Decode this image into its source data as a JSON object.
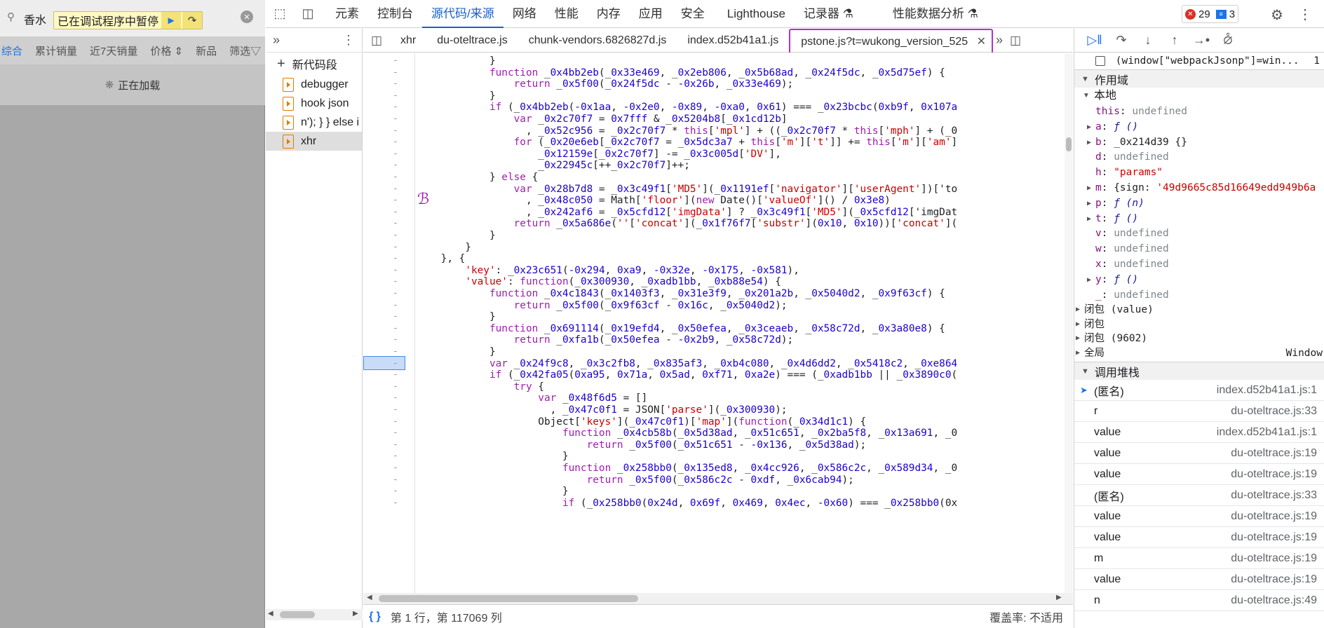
{
  "page": {
    "search_value": "香水",
    "paused_text": "已在调试程序中暂停",
    "filters": [
      "综合",
      "累计销量",
      "近7天销量",
      "价格 ⇕",
      "新品",
      "筛选▽"
    ],
    "loading_text": "正在加载"
  },
  "main_tabs": [
    "元素",
    "控制台",
    "源代码/来源",
    "网络",
    "性能",
    "内存",
    "应用",
    "安全",
    "Lighthouse",
    "记录器 ⚗",
    "性能数据分析 ⚗"
  ],
  "active_main_tab": "源代码/来源",
  "badges": {
    "errors": "29",
    "messages": "3"
  },
  "navigator": {
    "new_snippet": "新代码段",
    "snippets": [
      "debugger",
      "hook json",
      "n'); } } else i",
      "xhr"
    ]
  },
  "file_tabs": [
    "xhr",
    "du-oteltrace.js",
    "chunk-vendors.6826827d.js",
    "index.d52b41a1.js",
    "pstone.js?t=wukong_version_525"
  ],
  "active_file_tab": "pstone.js?t=wukong_version_525",
  "code_lines": [
    "            }",
    "            function _0x4bb2eb(_0x33e469, _0x2eb806, _0x5b68ad, _0x24f5dc, _0x5d75ef) {",
    "                return _0x5f00(_0x24f5dc - -0x26b, _0x33e469);",
    "            }",
    "            if (_0x4bb2eb(-0x1aa, -0x2e0, -0x89, -0xa0, 0x61) === _0x23bcbc(0xb9f, 0x107a",
    "                var _0x2c70f7 = 0x7fff & _0x5204b8[_0x1cd12b]",
    "                  , _0x52c956 = _0x2c70f7 * this['mpl'] + ((_0x2c70f7 * this['mph'] + (_0",
    "                for (_0x20e6eb[_0x2c70f7 = _0x5dc3a7 + this['m']['t']] += this['m']['am']",
    "                    _0x12159e[_0x2c70f7] -= _0x3c005d['DV'],",
    "                    _0x22945c[++_0x2c70f7]++;",
    "            } else {",
    "                var _0x28b7d8 = _0x3c49f1['MD5'](_0x1191ef['navigator']['userAgent'])['to",
    "                  , _0x48c050 = Math['floor'](new Date()['valueOf']() / 0x3e8)",
    "                  , _0x242af6 = _0x5cfd12['imgData'] ? _0x3c49f1['MD5'](_0x5cfd12['imgDat",
    "                return _0x5a686e(''['concat'](_0x1f76f7['substr'](0x10, 0x10))['concat'](",
    "            }",
    "        }",
    "    }, {",
    "        'key': _0x23c651(-0x294, 0xa9, -0x32e, -0x175, -0x581),",
    "        'value': function(_0x300930, _0xadb1bb, _0xb88e54) {",
    "            function _0x4c1843(_0x1403f3, _0x31e3f9, _0x201a2b, _0x5040d2, _0x9f63cf) {",
    "                return _0x5f00(_0x9f63cf - 0x16c, _0x5040d2);",
    "            }",
    "            function _0x691114(_0x19efd4, _0x50efea, _0x3ceaeb, _0x58c72d, _0x3a80e8) {",
    "                return _0xfa1b(_0x50efea - -0x2b9, _0x58c72d);",
    "            }",
    "            var _0x24f9c8, _0x3c2fb8, _0x835af3, _0xb4c080, _0x4d6dd2, _0x5418c2, _0xe864",
    "            if (_0x42fa05(0xa95, 0x71a, 0x5ad, 0xf71, 0xa2e) === (_0xadb1bb || _0x3890c0(",
    "                try {",
    "                    var _0x48f6d5 = []",
    "                      , _0x47c0f1 = JSON['parse'](_0x300930);",
    "                    Object['keys'](_0x47c0f1)['map'](function(_0x34d1c1) {",
    "                        function _0x4cb58b(_0x5d38ad, _0x51c651, _0x2ba5f8, _0x13a691, _0",
    "                            return _0x5f00(_0x51c651 - -0x136, _0x5d38ad);",
    "                        }",
    "                        function _0x258bb0(_0x135ed8, _0x4cc926, _0x586c2c, _0x589d34, _0",
    "                            return _0x5f00(_0x586c2c - 0xdf, _0x6cab94);",
    "                        }",
    "                        if (_0x258bb0(0x24d, 0x69f, 0x469, 0x4ec, -0x60) === _0x258bb0(0x"
  ],
  "breakpoint_line_index": 26,
  "status": {
    "position": "第 1 行，第 117069 列",
    "coverage": "覆盖率: 不适用"
  },
  "scope": {
    "top_entry": "(window[\"webpackJsonp\"]=win...",
    "top_entry_count": "1",
    "header": "作用域",
    "local_header": "本地",
    "vars": [
      {
        "name": "this",
        "value": "undefined",
        "kind": "und",
        "expand": false
      },
      {
        "name": "a",
        "value": "ƒ ()",
        "kind": "fn",
        "expand": true
      },
      {
        "name": "b",
        "value": "_0x214d39 {}",
        "kind": "plain",
        "expand": true
      },
      {
        "name": "d",
        "value": "undefined",
        "kind": "und",
        "expand": false
      },
      {
        "name": "h",
        "value": "\"params\"",
        "kind": "str",
        "expand": false
      },
      {
        "name": "m",
        "value": "{sign: '49d9665c85d16649edd949b6a",
        "kind": "obj",
        "expand": true
      },
      {
        "name": "p",
        "value": "ƒ (n)",
        "kind": "fn",
        "expand": true
      },
      {
        "name": "t",
        "value": "ƒ ()",
        "kind": "fn",
        "expand": true
      },
      {
        "name": "v",
        "value": "undefined",
        "kind": "und",
        "expand": false
      },
      {
        "name": "w",
        "value": "undefined",
        "kind": "und",
        "expand": false
      },
      {
        "name": "x",
        "value": "undefined",
        "kind": "und",
        "expand": false
      },
      {
        "name": "y",
        "value": "ƒ ()",
        "kind": "fn",
        "expand": true
      },
      {
        "name": "_",
        "value": "undefined",
        "kind": "und",
        "expand": false
      }
    ],
    "closures": [
      "闭包 (value)",
      "闭包",
      "闭包 (9602)",
      "全局"
    ],
    "global_value": "Window"
  },
  "callstack": {
    "header": "调用堆栈",
    "frames": [
      {
        "name": "(匿名)",
        "loc": "index.d52b41a1.js:1",
        "current": true
      },
      {
        "name": "r",
        "loc": "du-oteltrace.js:33"
      },
      {
        "name": "value",
        "loc": "index.d52b41a1.js:1"
      },
      {
        "name": "value",
        "loc": "du-oteltrace.js:19"
      },
      {
        "name": "value",
        "loc": "du-oteltrace.js:19"
      },
      {
        "name": "(匿名)",
        "loc": "du-oteltrace.js:33"
      },
      {
        "name": "value",
        "loc": "du-oteltrace.js:19"
      },
      {
        "name": "value",
        "loc": "du-oteltrace.js:19"
      },
      {
        "name": "m",
        "loc": "du-oteltrace.js:19"
      },
      {
        "name": "value",
        "loc": "du-oteltrace.js:19"
      },
      {
        "name": "n",
        "loc": "du-oteltrace.js:49"
      }
    ]
  }
}
